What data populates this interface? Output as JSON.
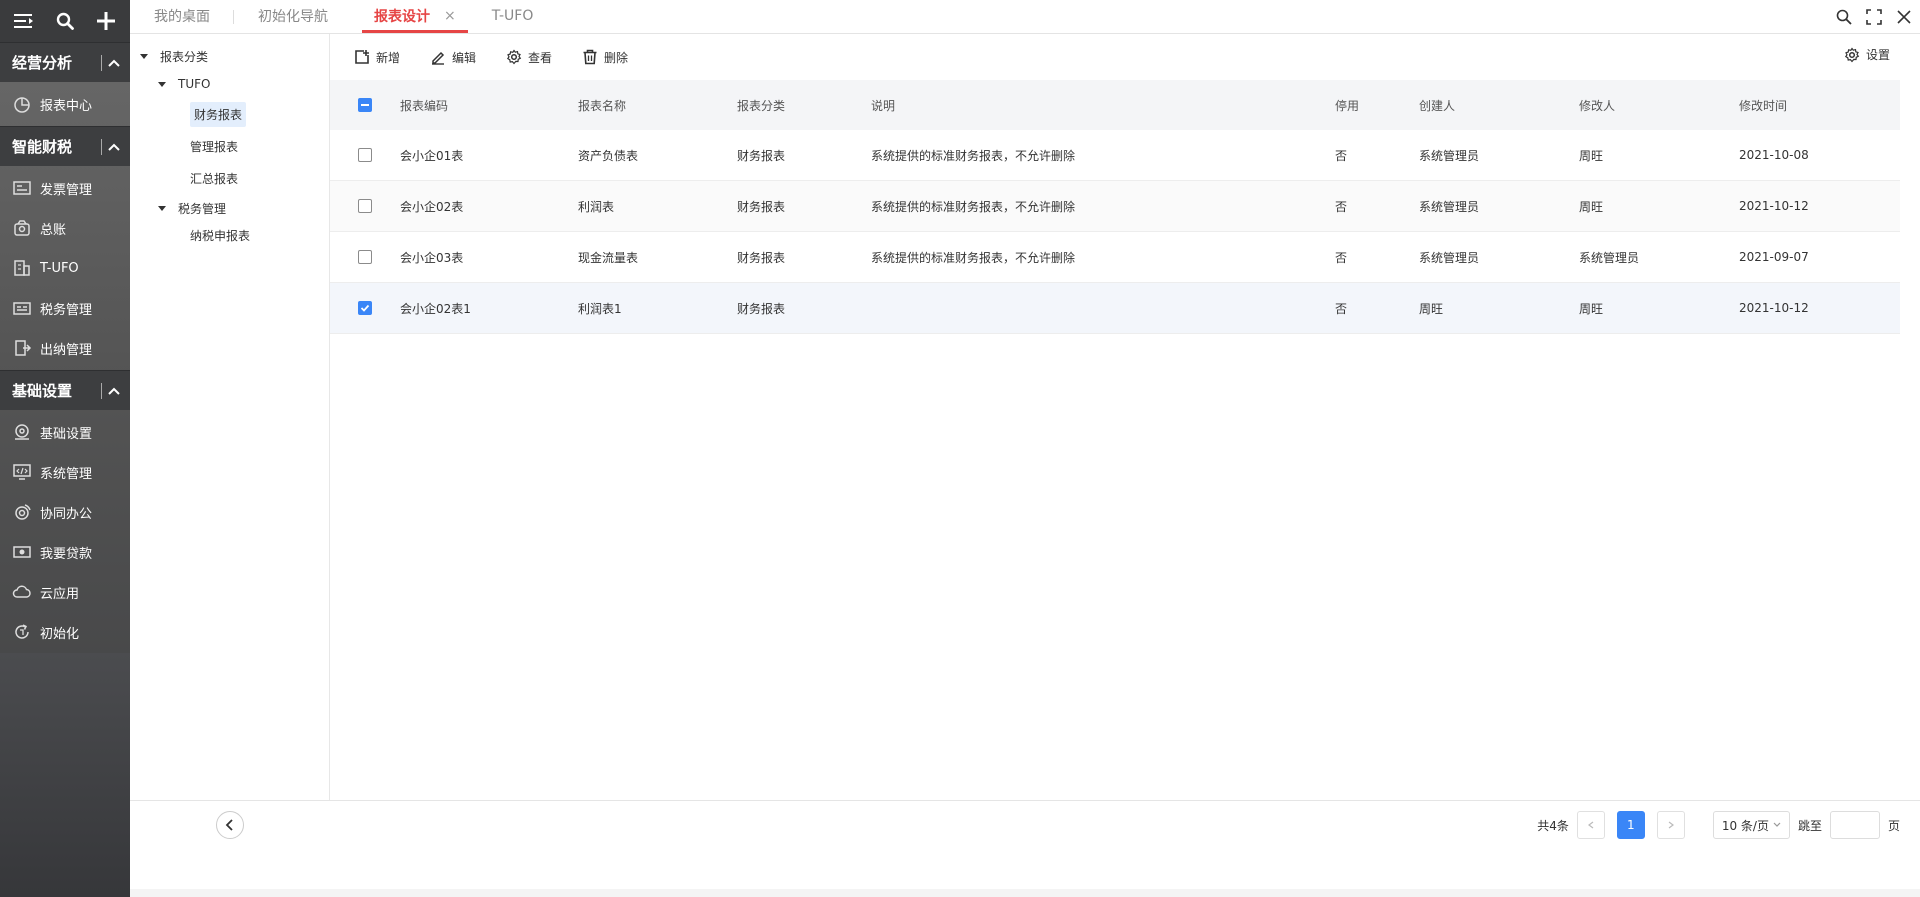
{
  "sidebar": {
    "groups": [
      {
        "title": "经营分析",
        "items": [
          {
            "label": "报表中心",
            "icon": "report-icon"
          }
        ]
      },
      {
        "title": "智能财税",
        "items": [
          {
            "label": "发票管理",
            "icon": "invoice-icon"
          },
          {
            "label": "总账",
            "icon": "ledger-icon"
          },
          {
            "label": "T-UFO",
            "icon": "building-icon"
          },
          {
            "label": "税务管理",
            "icon": "tax-icon"
          },
          {
            "label": "出纳管理",
            "icon": "cashier-icon"
          }
        ]
      },
      {
        "title": "基础设置",
        "items": [
          {
            "label": "基础设置",
            "icon": "gear-badge-icon"
          },
          {
            "label": "系统管理",
            "icon": "monitor-code-icon"
          },
          {
            "label": "协同办公",
            "icon": "collab-icon"
          },
          {
            "label": "我要贷款",
            "icon": "money-icon"
          },
          {
            "label": "云应用",
            "icon": "cloud-icon"
          },
          {
            "label": "初始化",
            "icon": "refresh-icon"
          }
        ]
      }
    ]
  },
  "tabs": [
    {
      "label": "我的桌面"
    },
    {
      "label": "初始化导航"
    },
    {
      "label": "报表设计",
      "active": true,
      "close": "×"
    },
    {
      "label": "T-UFO"
    }
  ],
  "tree": {
    "root": "报表分类",
    "n1": "TUFO",
    "n1a": "财务报表",
    "n1b": "管理报表",
    "n1c": "汇总报表",
    "n2": "税务管理",
    "n2a": "纳税申报表"
  },
  "toolbar": {
    "add": "新增",
    "edit": "编辑",
    "view": "查看",
    "delete": "删除",
    "settings": "设置"
  },
  "table": {
    "headers": {
      "code": "报表编码",
      "name": "报表名称",
      "cat": "报表分类",
      "desc": "说明",
      "stop": "停用",
      "creator": "创建人",
      "modifier": "修改人",
      "time": "修改时间"
    },
    "rows": [
      {
        "code": "会小企01表",
        "name": "资产负债表",
        "cat": "财务报表",
        "desc": "系统提供的标准财务报表，不允许删除",
        "stop": "否",
        "creator": "系统管理员",
        "modifier": "周旺",
        "time": "2021-10-08",
        "checked": false
      },
      {
        "code": "会小企02表",
        "name": "利润表",
        "cat": "财务报表",
        "desc": "系统提供的标准财务报表，不允许删除",
        "stop": "否",
        "creator": "系统管理员",
        "modifier": "周旺",
        "time": "2021-10-12",
        "checked": false
      },
      {
        "code": "会小企03表",
        "name": "现金流量表",
        "cat": "财务报表",
        "desc": "系统提供的标准财务报表，不允许删除",
        "stop": "否",
        "creator": "系统管理员",
        "modifier": "系统管理员",
        "time": "2021-09-07",
        "checked": false
      },
      {
        "code": "会小企02表1",
        "name": "利润表1",
        "cat": "财务报表",
        "desc": "",
        "stop": "否",
        "creator": "周旺",
        "modifier": "周旺",
        "time": "2021-10-12",
        "checked": true
      }
    ]
  },
  "pager": {
    "total": "共4条",
    "page": "1",
    "size": "10 条/页",
    "jump_label": "跳至",
    "page_unit": "页"
  },
  "colors": {
    "accent": "#3a86f7",
    "tab_active": "#e64545"
  }
}
